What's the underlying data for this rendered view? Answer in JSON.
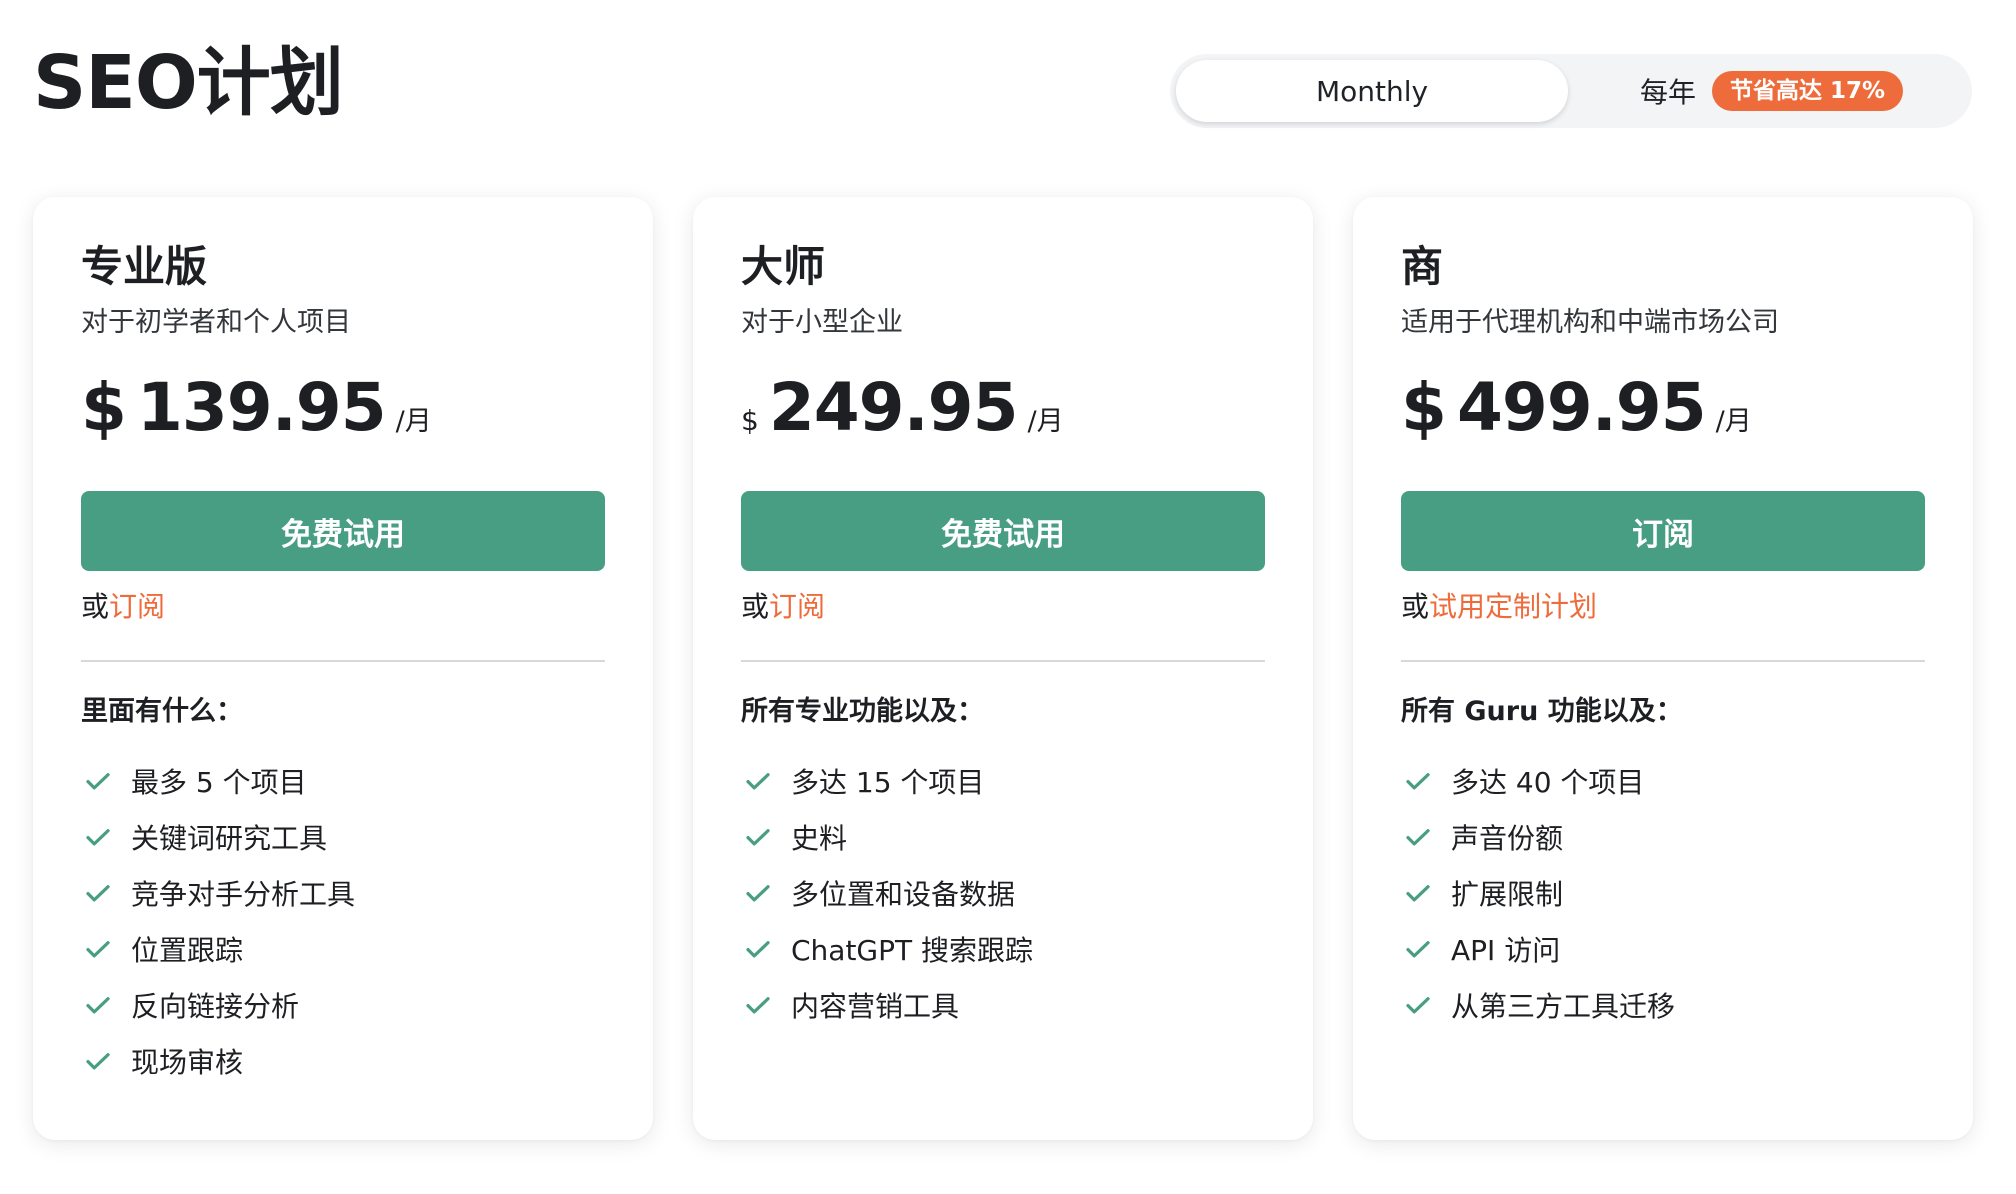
{
  "page_title": "SEO计划",
  "billing": {
    "monthly_label": "Monthly",
    "yearly_label": "每年",
    "yearly_badge": "节省高达 17%",
    "selected": "monthly"
  },
  "colors": {
    "accent_green": "#489e83",
    "accent_orange": "#ee6c3c",
    "text_dark": "#1e1f23"
  },
  "plans": [
    {
      "name": "专业版",
      "description": "对于初学者和个人项目",
      "currency": "$",
      "amount": "139.95",
      "period": "/月",
      "cta": "免费试用",
      "alt_prefix": "或",
      "alt_link": "订阅",
      "features_heading": "里面有什么：",
      "features": [
        "最多 5 个项目",
        "关键词研究工具",
        "竞争对手分析工具",
        "位置跟踪",
        "反向链接分析",
        "现场审核"
      ]
    },
    {
      "name": "大师",
      "description": "对于小型企业",
      "currency": "$",
      "amount": "249.95",
      "period": "/月",
      "cta": "免费试用",
      "alt_prefix": "或",
      "alt_link": "订阅",
      "features_heading": "所有专业功能以及：",
      "features": [
        "多达 15 个项目",
        "史料",
        "多位置和设备数据",
        "ChatGPT 搜索跟踪",
        "内容营销工具"
      ]
    },
    {
      "name": "商",
      "description": "适用于代理机构和中端市场公司",
      "currency": "$",
      "amount": "499.95",
      "period": "/月",
      "cta": "订阅",
      "alt_prefix": "或",
      "alt_link": "试用定制计划",
      "features_heading": "所有 Guru 功能以及：",
      "features": [
        "多达 40 个项目",
        "声音份额",
        "扩展限制",
        "API 访问",
        "从第三方工具迁移"
      ]
    }
  ]
}
